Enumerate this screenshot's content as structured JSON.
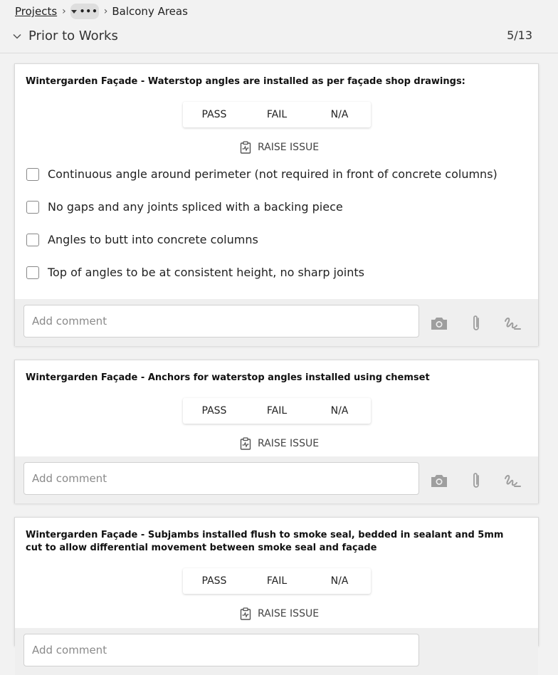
{
  "breadcrumb": {
    "root": "Projects",
    "more": "•••",
    "current": "Balcony Areas"
  },
  "section": {
    "title": "Prior to Works",
    "counter": "5/13"
  },
  "segment": {
    "pass": "PASS",
    "fail": "FAIL",
    "na": "N/A"
  },
  "raise_issue": "RAISE ISSUE",
  "comment_placeholder": "Add comment",
  "items": [
    {
      "title": "Wintergarden Façade - Waterstop angles are installed as per façade shop drawings:",
      "checks": [
        "Continuous angle around perimeter (not required in front of concrete columns)",
        "No gaps and any joints spliced with a backing piece",
        "Angles to butt into concrete columns",
        "Top of angles to be at consistent height, no sharp joints"
      ]
    },
    {
      "title": "Wintergarden Façade - Anchors for waterstop angles installed using chemset"
    },
    {
      "title": "Wintergarden Façade - Subjambs installed flush to smoke seal, bedded in sealant and 5mm cut to allow differential movement between smoke seal and façade"
    }
  ],
  "icons": [
    "chevron-down-icon",
    "clipboard-issue-icon",
    "camera-icon",
    "paperclip-icon",
    "signature-icon"
  ],
  "colors": {
    "background": "#f2f2f2",
    "card": "#ffffff",
    "comment_bar": "#efefef",
    "icon": "#9e9e9e"
  }
}
